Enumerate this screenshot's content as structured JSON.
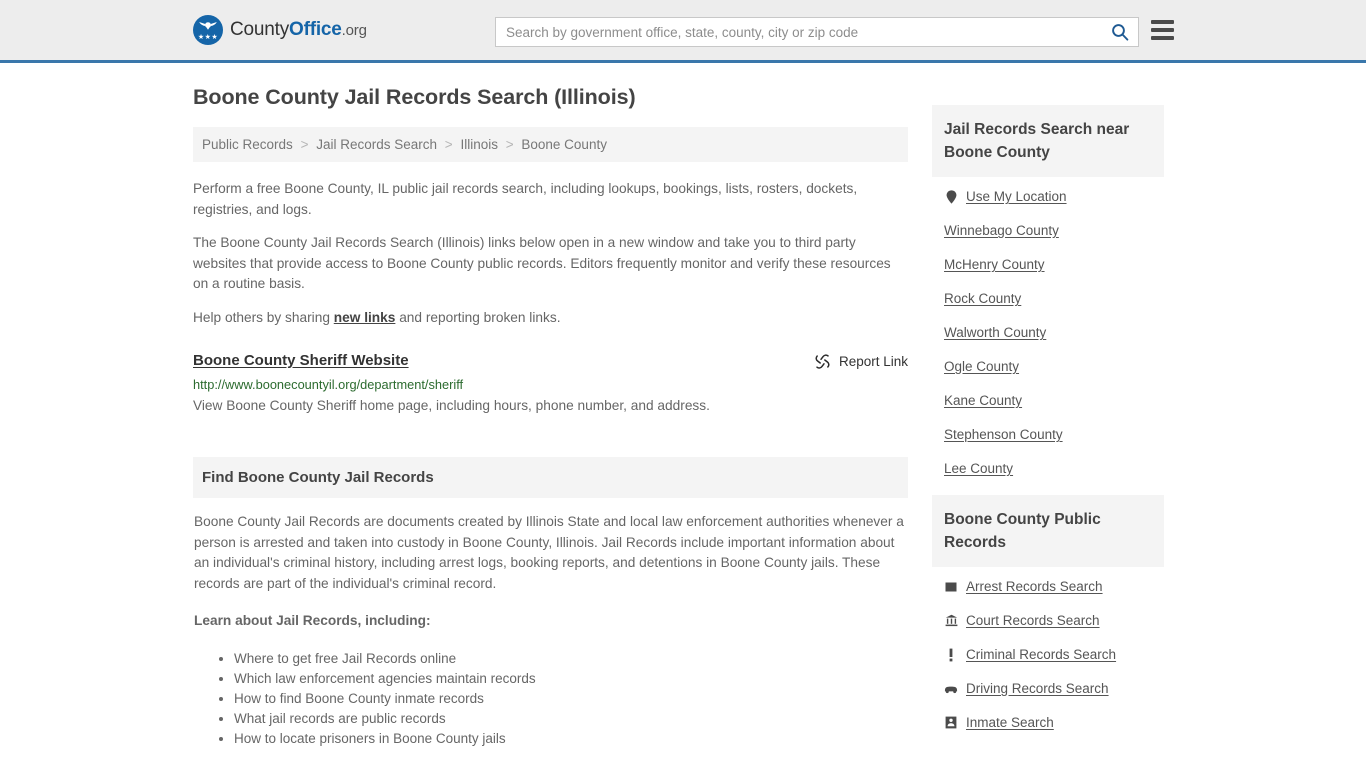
{
  "header": {
    "logo": {
      "part1": "County",
      "part2": "Office",
      "part3": ".org",
      "icon": "eagle-seal-icon",
      "stars": "★★★"
    },
    "search": {
      "placeholder": "Search by government office, state, county, city or zip code",
      "value": "",
      "search_icon": "search-icon"
    },
    "menu_icon": "hamburger-menu-icon"
  },
  "colors": {
    "header_bg": "#ededed",
    "header_border": "#3a77ab",
    "brand_blue": "#1565a8",
    "panel_bg": "#f4f4f4",
    "url_green": "#2c6b2f",
    "body_text": "#666666"
  },
  "main": {
    "title": "Boone County Jail Records Search (Illinois)",
    "breadcrumb": [
      {
        "label": "Public Records",
        "current": false
      },
      {
        "label": "Jail Records Search",
        "current": false
      },
      {
        "label": "Illinois",
        "current": false
      },
      {
        "label": "Boone County",
        "current": true
      }
    ],
    "breadcrumb_separator": ">",
    "intro_paragraph": "Perform a free Boone County, IL public jail records search, including lookups, bookings, lists, rosters, dockets, registries, and logs.",
    "description_paragraph": "The Boone County Jail Records Search (Illinois) links below open in a new window and take you to third party websites that provide access to Boone County public records. Editors frequently monitor and verify these resources on a routine basis.",
    "help_prefix": "Help others by sharing ",
    "help_link": "new links",
    "help_suffix": " and reporting broken links.",
    "link_entries": [
      {
        "title": "Boone County Sheriff Website",
        "url": "http://www.boonecountyil.org/department/sheriff",
        "description": "View Boone County Sheriff home page, including hours, phone number, and address.",
        "report_label": "Report Link",
        "report_icon": "broken-link-icon"
      }
    ],
    "section": {
      "heading": "Find Boone County Jail Records",
      "paragraph": "Boone County Jail Records are documents created by Illinois State and local law enforcement authorities whenever a person is arrested and taken into custody in Boone County, Illinois. Jail Records include important information about an individual's criminal history, including arrest logs, booking reports, and detentions in Boone County jails. These records are part of the individual's criminal record.",
      "learn_heading": "Learn about Jail Records, including:",
      "learn_items": [
        "Where to get free Jail Records online",
        "Which law enforcement agencies maintain records",
        "How to find Boone County inmate records",
        "What jail records are public records",
        "How to locate prisoners in Boone County jails"
      ]
    }
  },
  "sidebar": {
    "nearby": {
      "heading": "Jail Records Search near Boone County",
      "items": [
        {
          "label": "Use My Location",
          "icon": "map-pin-icon"
        },
        {
          "label": "Winnebago County",
          "icon": ""
        },
        {
          "label": "McHenry County",
          "icon": ""
        },
        {
          "label": "Rock County",
          "icon": ""
        },
        {
          "label": "Walworth County",
          "icon": ""
        },
        {
          "label": "Ogle County",
          "icon": ""
        },
        {
          "label": "Kane County",
          "icon": ""
        },
        {
          "label": "Stephenson County",
          "icon": ""
        },
        {
          "label": "Lee County",
          "icon": ""
        }
      ]
    },
    "public_records": {
      "heading": "Boone County Public Records",
      "items": [
        {
          "label": "Arrest Records Search",
          "icon": "square-icon"
        },
        {
          "label": "Court Records Search",
          "icon": "courthouse-icon"
        },
        {
          "label": "Criminal Records Search",
          "icon": "exclamation-icon"
        },
        {
          "label": "Driving Records Search",
          "icon": "car-icon"
        },
        {
          "label": "Inmate Search",
          "icon": "id-card-icon"
        }
      ]
    }
  }
}
